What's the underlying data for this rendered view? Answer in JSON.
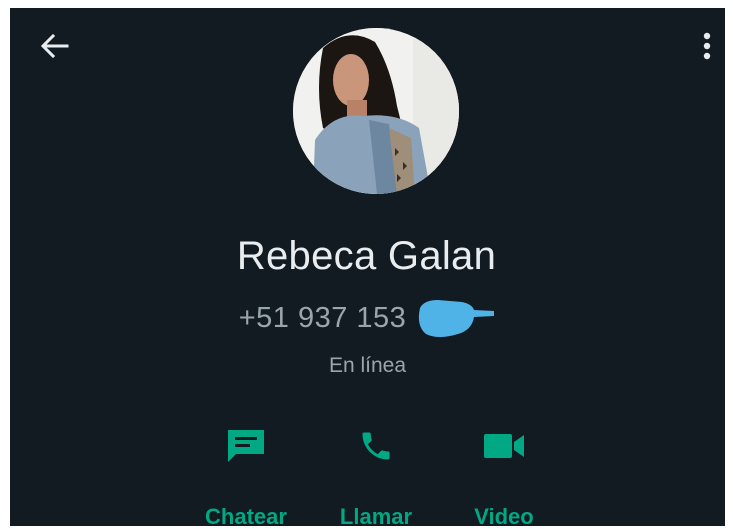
{
  "contact": {
    "name": "Rebeca Galan",
    "phone_visible": "+51 937 153",
    "status": "En línea"
  },
  "actions": [
    {
      "label": "Chatear",
      "icon": "message-icon"
    },
    {
      "label": "Llamar",
      "icon": "phone-icon"
    },
    {
      "label": "Video",
      "icon": "video-icon"
    }
  ],
  "toolbar": {
    "back_icon": "arrow-left-icon",
    "menu_icon": "more-vert-icon"
  },
  "colors": {
    "background": "#121b22",
    "accent": "#00a884",
    "name_text": "#e9edef",
    "secondary_text": "#9aa5ac",
    "redaction": "#4fb3e8"
  }
}
